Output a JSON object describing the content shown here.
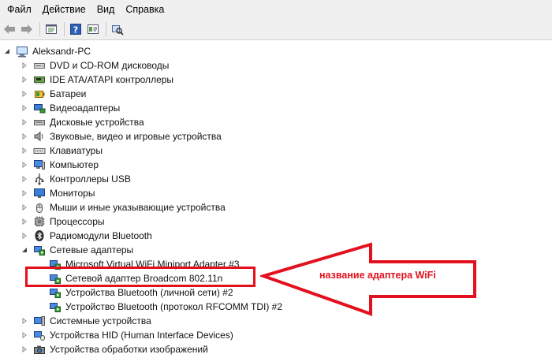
{
  "menu": {
    "file": "Файл",
    "action": "Действие",
    "view": "Вид",
    "help": "Справка"
  },
  "toolbar": {
    "buttons": [
      "back-icon",
      "forward-icon",
      "tree-view-icon",
      "help-icon",
      "properties-icon",
      "scan-hardware-icon"
    ]
  },
  "tree": {
    "root": "Aleksandr-PC",
    "categories": [
      "DVD и CD-ROM дисководы",
      "IDE ATA/ATAPI контроллеры",
      "Батареи",
      "Видеоадаптеры",
      "Дисковые устройства",
      "Звуковые, видео и игровые устройства",
      "Клавиатуры",
      "Компьютер",
      "Контроллеры USB",
      "Мониторы",
      "Мыши и иные указывающие устройства",
      "Процессоры",
      "Радиомодули Bluetooth",
      "Сетевые адаптеры"
    ],
    "network_adapters": [
      "Microsoft Virtual WiFi Miniport Adapter #3",
      "Сетевой адаптер Broadcom 802.11n",
      "Устройства Bluetooth (личной сети) #2",
      "Устройство Bluetooth (протокол RFCOMM TDI) #2"
    ],
    "after": [
      "Системные устройства",
      "Устройства HID (Human Interface Devices)",
      "Устройства обработки изображений"
    ]
  },
  "annotation": {
    "label": "название адаптера WiFi",
    "color": "#e3101e"
  }
}
